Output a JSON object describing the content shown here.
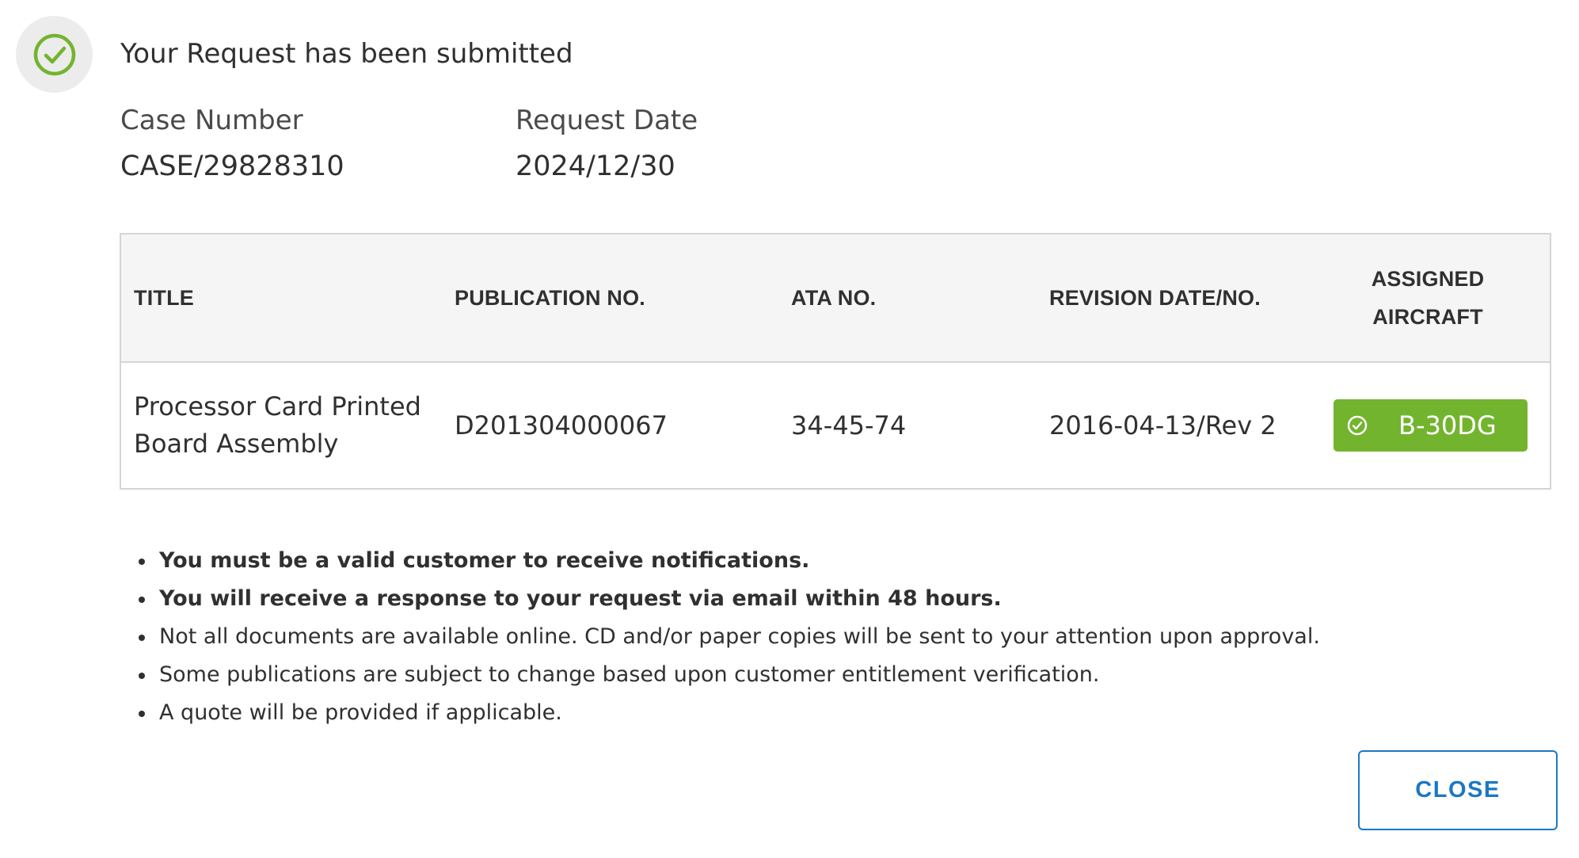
{
  "dialog": {
    "title": "Your Request has been submitted",
    "icon": "check-circle-icon",
    "accent_color": "#73b42f"
  },
  "meta": {
    "case_label": "Case Number",
    "case_value": "CASE/29828310",
    "date_label": "Request Date",
    "date_value": "2024/12/30"
  },
  "table": {
    "headers": {
      "title": "TITLE",
      "publication": "PUBLICATION NO.",
      "ata": "ATA NO.",
      "revision": "REVISION DATE/NO.",
      "aircraft_line1": "ASSIGNED",
      "aircraft_line2": "AIRCRAFT"
    },
    "rows": [
      {
        "title": "Processor Card Printed Board Assembly",
        "publication": "D201304000067",
        "ata": "34-45-74",
        "revision": "2016-04-13/Rev 2",
        "aircraft": "B-30DG",
        "aircraft_icon": "check-circle-icon",
        "aircraft_color": "#73b42f"
      }
    ]
  },
  "notes": [
    "You must be a valid customer to receive notifications.",
    "You will receive a response to your request via email within 48 hours.",
    "Not all documents are available online. CD and/or paper copies will be sent to your attention upon approval.",
    "Some publications are subject to change based upon customer entitlement verification.",
    "A quote will be provided if applicable."
  ],
  "actions": {
    "close_label": "CLOSE",
    "close_color": "#1b78c4"
  }
}
